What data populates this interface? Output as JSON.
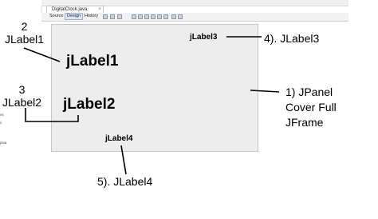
{
  "editor": {
    "file_tab": "DigitalClock.java",
    "tabs": [
      "Source",
      "Design",
      "History"
    ],
    "active_tab": "Design"
  },
  "left_panel": {
    "fragments": [
      "ns",
      "s",
      "java"
    ]
  },
  "form": {
    "labels": {
      "label1": "jLabel1",
      "label2": "jLabel2",
      "label3": "jLabel3",
      "label4": "jLabel4"
    }
  },
  "annotations": {
    "a1": "2\nJLabel1",
    "a2": "3\nJLabel2",
    "a3": "4). JLabel3",
    "a4": "5). JLabel4",
    "a5": "1) JPanel\nCover Full\nJFrame"
  }
}
